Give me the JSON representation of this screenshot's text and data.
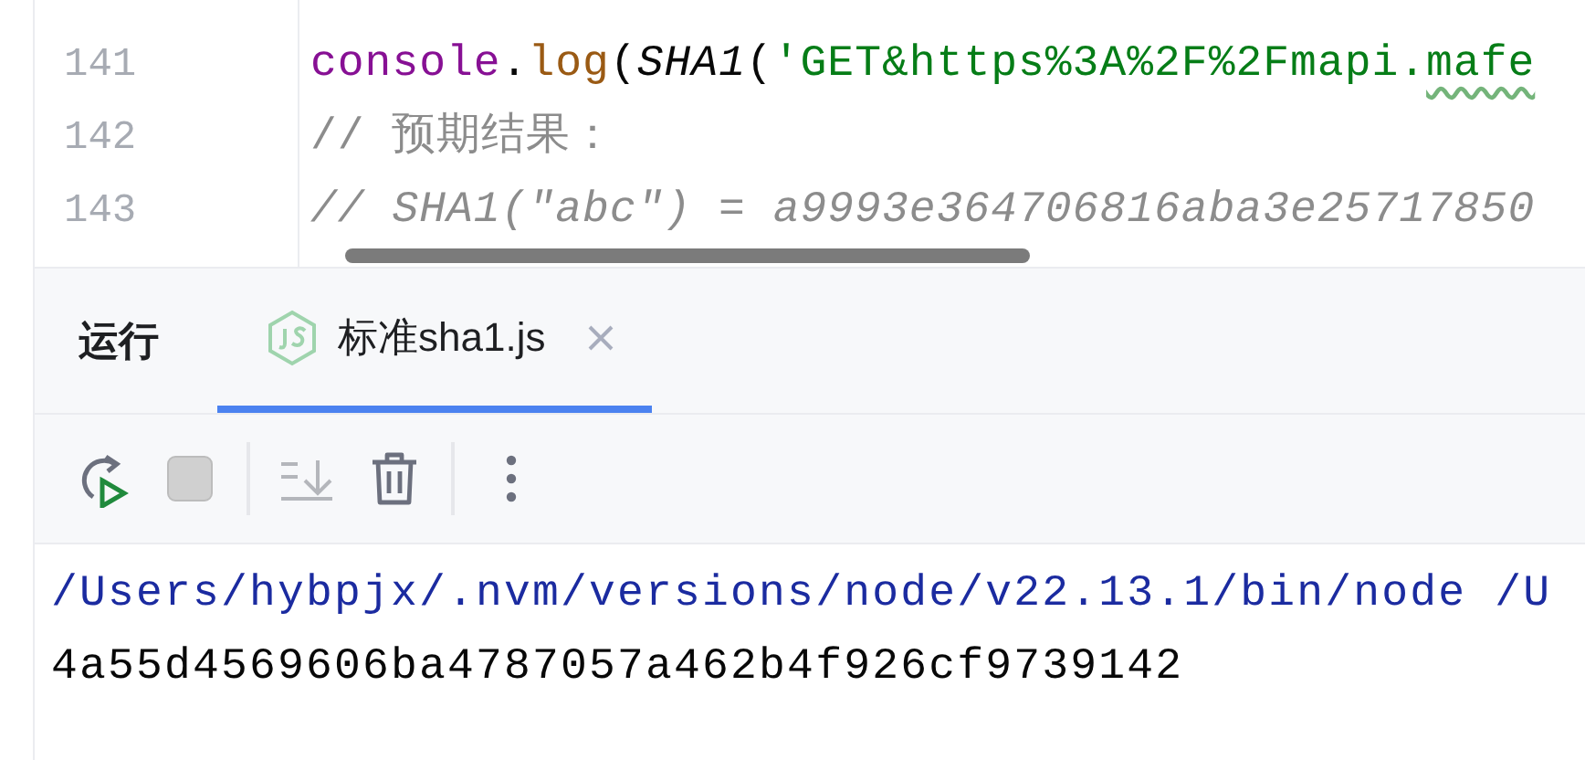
{
  "editor": {
    "lines": [
      {
        "number": "141",
        "segments": [
          {
            "text": "console",
            "kind": "keyword"
          },
          {
            "text": ".",
            "kind": "plain"
          },
          {
            "text": "log",
            "kind": "method"
          },
          {
            "text": "(",
            "kind": "plain"
          },
          {
            "text": "SHA1",
            "kind": "function"
          },
          {
            "text": "(",
            "kind": "plain"
          },
          {
            "text": "'GET&https%3A%2F%2Fmapi.",
            "kind": "string"
          },
          {
            "text": "mafe",
            "kind": "string",
            "typo": true
          }
        ]
      },
      {
        "number": "142",
        "segments": [
          {
            "text": "// 预期结果：",
            "kind": "comment"
          }
        ]
      },
      {
        "number": "143",
        "segments": [
          {
            "text": "// SHA1(\"abc\") = a9993e364706816aba3e25717850",
            "kind": "doc-comment"
          }
        ]
      }
    ]
  },
  "run_panel": {
    "title": "运行",
    "tabs": [
      {
        "label": "标准sha1.js",
        "selected": true,
        "closable": true
      }
    ],
    "toolbar": [
      {
        "kind": "rerun",
        "disabled": false
      },
      {
        "kind": "stop",
        "disabled": true
      },
      {
        "kind": "separator"
      },
      {
        "kind": "scroll-end",
        "disabled": true
      },
      {
        "kind": "clear",
        "disabled": false
      },
      {
        "kind": "separator"
      },
      {
        "kind": "more",
        "disabled": false
      }
    ],
    "console": [
      {
        "text": "/Users/hybpjx/.nvm/versions/node/v22.13.1/bin/node /U",
        "kind": "command"
      },
      {
        "text": "4a55d4569606ba4787057a462b4f926cf9739142",
        "kind": "output"
      }
    ]
  }
}
